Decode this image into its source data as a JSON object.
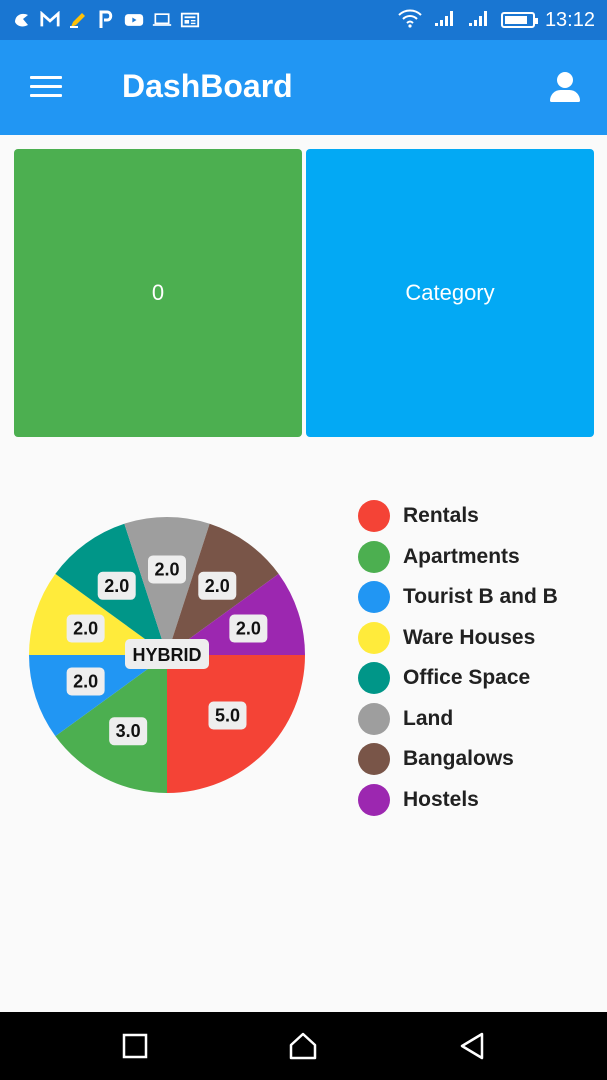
{
  "status_bar": {
    "icons": [
      "app-icon",
      "gmail-icon",
      "pencil-icon",
      "paypal-icon",
      "youtube-icon",
      "laptop-icon",
      "news-icon"
    ],
    "time": "13:12",
    "battery_level": 0.85
  },
  "app_bar": {
    "title": "DashBoard",
    "menu_icon": "menu-icon",
    "profile_icon": "person-icon"
  },
  "cards": {
    "count": {
      "value": "0",
      "color": "#4caf50"
    },
    "category": {
      "label": "Category",
      "color": "#03a9f4"
    }
  },
  "chart_data": {
    "type": "pie",
    "center_label": "HYBRID",
    "categories": [
      "Rentals",
      "Apartments",
      "Tourist B and B",
      "Ware Houses",
      "Office Space",
      "Land",
      "Bangalows",
      "Hostels"
    ],
    "values": [
      5.0,
      3.0,
      2.0,
      2.0,
      2.0,
      2.0,
      2.0,
      2.0
    ],
    "value_labels": [
      "5.0",
      "3.0",
      "2.0",
      "2.0",
      "2.0",
      "2.0",
      "2.0",
      "2.0"
    ],
    "colors": [
      "#f44336",
      "#4caf50",
      "#2196f3",
      "#ffeb3b",
      "#009688",
      "#9e9e9e",
      "#795548",
      "#9c27b0"
    ],
    "legend_position": "right"
  },
  "nav_bar": {
    "recents_icon": "square-icon",
    "home_icon": "home-icon",
    "back_icon": "back-triangle-icon"
  }
}
